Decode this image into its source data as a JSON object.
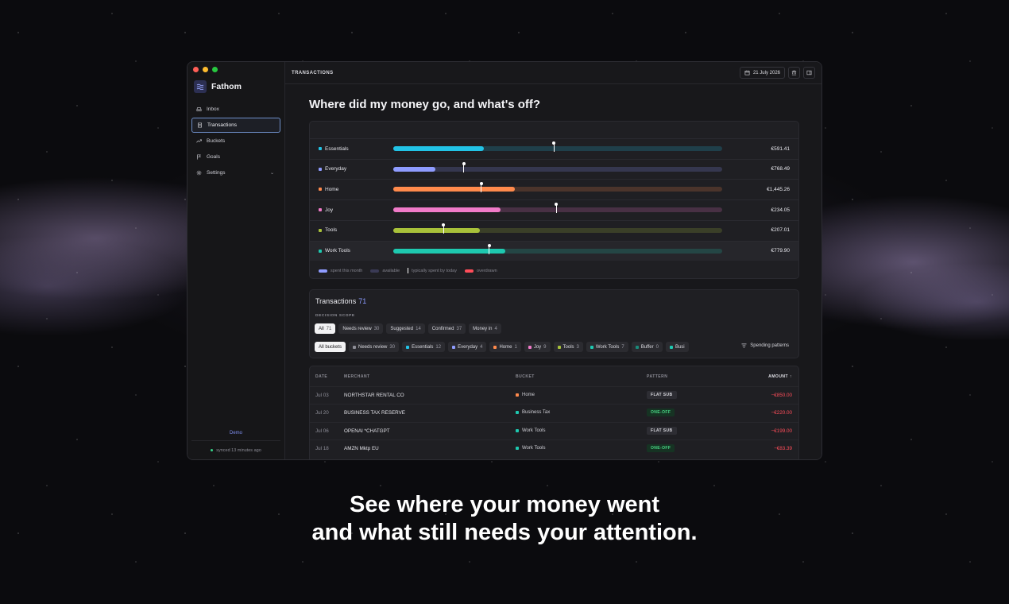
{
  "window": {
    "traffic_colors": [
      "#ff5f57",
      "#febc2e",
      "#28c840"
    ],
    "app_name": "Fathom",
    "page_title": "TRANSACTIONS",
    "date_label": "21 July 2026"
  },
  "sidebar": {
    "items": [
      {
        "label": "Inbox",
        "icon": "inbox-icon",
        "active": false
      },
      {
        "label": "Transactions",
        "icon": "receipt-icon",
        "active": true
      },
      {
        "label": "Buckets",
        "icon": "trend-icon",
        "active": false
      },
      {
        "label": "Goals",
        "icon": "flag-icon",
        "active": false
      },
      {
        "label": "Settings",
        "icon": "gear-icon",
        "active": false
      }
    ],
    "demo_label": "Demo",
    "sync_status": "synced 13 minutes ago"
  },
  "main": {
    "headline": "Where did my money go, and what's off?"
  },
  "budget": {
    "rows": [
      {
        "name": "Essentials",
        "color": "#22c3e6",
        "spent_fraction": 0.275,
        "typical_fraction": 0.487,
        "amount": "€591.41"
      },
      {
        "name": "Everyday",
        "color": "#8f9cff",
        "spent_fraction": 0.128,
        "typical_fraction": 0.213,
        "amount": "€768.49"
      },
      {
        "name": "Home",
        "color": "#ff8a4c",
        "spent_fraction": 0.37,
        "typical_fraction": 0.266,
        "amount": "€1,445.26"
      },
      {
        "name": "Joy",
        "color": "#f07ac8",
        "spent_fraction": 0.326,
        "typical_fraction": 0.495,
        "amount": "€234.05"
      },
      {
        "name": "Tools",
        "color": "#a8c13a",
        "spent_fraction": 0.263,
        "typical_fraction": 0.152,
        "amount": "€207.01"
      },
      {
        "name": "Work Tools",
        "color": "#1ec9b0",
        "spent_fraction": 0.341,
        "typical_fraction": 0.29,
        "amount": "€779.90"
      }
    ],
    "legend": {
      "spent": "spent this month",
      "available": "available",
      "typical": "typically spent by today",
      "overdrawn": "overdrawn",
      "spent_color": "#8f9cff",
      "available_color": "#3a3a55",
      "overdrawn_color": "#ff4d5a"
    }
  },
  "transactions": {
    "title": "Transactions",
    "count": "71",
    "scope_label": "DECISION SCOPE",
    "scope_chips": [
      {
        "label": "All",
        "count": "71",
        "active": true
      },
      {
        "label": "Needs review",
        "count": "30",
        "active": false
      },
      {
        "label": "Suggested",
        "count": "14",
        "active": false
      },
      {
        "label": "Confirmed",
        "count": "37",
        "active": false
      },
      {
        "label": "Money in",
        "count": "4",
        "active": false
      }
    ],
    "bucket_chips": [
      {
        "label": "All buckets",
        "count": "",
        "color": "",
        "active": true
      },
      {
        "label": "Needs review",
        "count": "30",
        "color": "#8d8d96",
        "active": false
      },
      {
        "label": "Essentials",
        "count": "12",
        "color": "#22c3e6",
        "active": false
      },
      {
        "label": "Everyday",
        "count": "4",
        "color": "#8f9cff",
        "active": false
      },
      {
        "label": "Home",
        "count": "1",
        "color": "#ff8a4c",
        "active": false
      },
      {
        "label": "Joy",
        "count": "9",
        "color": "#f07ac8",
        "active": false
      },
      {
        "label": "Tools",
        "count": "3",
        "color": "#a8c13a",
        "active": false
      },
      {
        "label": "Work Tools",
        "count": "7",
        "color": "#1ec9b0",
        "active": false
      },
      {
        "label": "Buffer",
        "count": "0",
        "color": "#1a8a7a",
        "active": false
      },
      {
        "label": "Busi",
        "count": "",
        "color": "#1ec9b0",
        "active": false
      }
    ],
    "patterns_label": "Spending patterns"
  },
  "table": {
    "headers": {
      "date": "DATE",
      "merchant": "MERCHANT",
      "bucket": "BUCKET",
      "pattern": "PATTERN",
      "amount": "AMOUNT ↑"
    },
    "rows": [
      {
        "date": "Jul 03",
        "merchant": "NORTHSTAR RENTAL CO",
        "bucket": "Home",
        "bucket_color": "#ff8a4c",
        "pattern": "FLAT SUB",
        "pattern_type": "flat",
        "amount": "−€850.00"
      },
      {
        "date": "Jul 20",
        "merchant": "BUSINESS TAX RESERVE",
        "bucket": "Business Tax",
        "bucket_color": "#1ec9b0",
        "pattern": "ONE-OFF",
        "pattern_type": "oneoff",
        "amount": "−€220.00"
      },
      {
        "date": "Jul 06",
        "merchant": "OPENAI *CHATGPT",
        "bucket": "Work Tools",
        "bucket_color": "#1ec9b0",
        "pattern": "FLAT SUB",
        "pattern_type": "flat",
        "amount": "−€199.00"
      },
      {
        "date": "Jul 18",
        "merchant": "AMZN Mktp EU",
        "bucket": "Work Tools",
        "bucket_color": "#1ec9b0",
        "pattern": "ONE-OFF",
        "pattern_type": "oneoff",
        "amount": "−€83.39"
      }
    ]
  },
  "tagline": {
    "line1": "See where your money went",
    "line2": "and what still needs your attention."
  }
}
